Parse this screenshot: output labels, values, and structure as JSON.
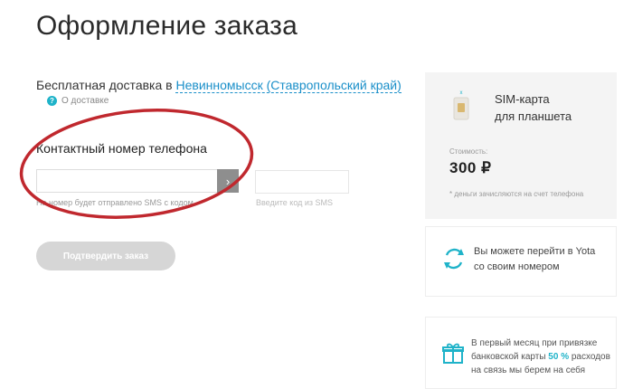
{
  "header": {
    "title": "Оформление заказа"
  },
  "delivery": {
    "prefix": "Бесплатная доставка в ",
    "city": "Невинномысск (Ставропольский край)",
    "about_label": "О доставке"
  },
  "phone": {
    "label": "Контактный номер телефона",
    "value": "",
    "hint": "На номер будет отправлено SMS с кодом",
    "go_glyph": "›"
  },
  "sms": {
    "value": "",
    "hint": "Введите код из SMS"
  },
  "confirm": {
    "label": "Подтвердить заказ"
  },
  "product": {
    "title_line1": "SIM-карта",
    "title_line2": "для планшета",
    "price_label": "Стоимость:",
    "price": "300 ₽",
    "price_note": "* деньги зачисляются на счет телефона"
  },
  "switch_card": {
    "line1": "Вы можете перейти в Yota",
    "line2": "со своим номером"
  },
  "bank_card": {
    "line1": "В первый месяц при привязке",
    "line2_prefix": "банковской карты ",
    "line2_pct": "50 %",
    "line2_suffix": " расходов",
    "line3": "на связь мы берем на себя"
  },
  "colors": {
    "accent": "#1fb3c9",
    "link": "#1a8fc9",
    "highlight_ellipse": "#c0282e",
    "button_disabled": "#d6d6d6"
  },
  "icons": [
    "help-icon",
    "arrow-right-icon",
    "sim-card-icon",
    "switch-arrows-icon",
    "gift-icon"
  ]
}
